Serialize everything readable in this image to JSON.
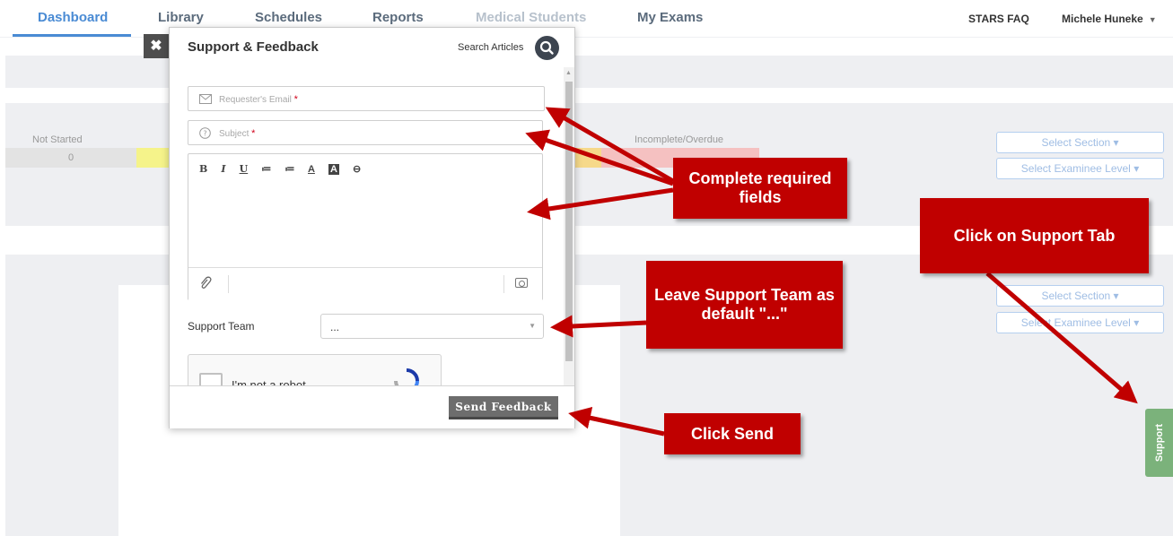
{
  "nav": {
    "items": [
      {
        "label": "Dashboard",
        "state": "active"
      },
      {
        "label": "Library",
        "state": "normal"
      },
      {
        "label": "Schedules",
        "state": "normal"
      },
      {
        "label": "Reports",
        "state": "normal"
      },
      {
        "label": "Medical Students",
        "state": "disabled"
      },
      {
        "label": "My Exams",
        "state": "normal"
      }
    ],
    "faq": "STARS FAQ",
    "user": "Michele Huneke"
  },
  "dashboard": {
    "status_not_started": "Not Started",
    "status_not_started_count": "0",
    "status_incomplete": "Incomplete/Overdue",
    "select_section": "Select Section",
    "select_examinee_level": "Select Examinee Level"
  },
  "panel": {
    "close_symbol": "✖",
    "title": "Support & Feedback",
    "search_label": "Search Articles",
    "email_placeholder": "Requester's Email",
    "subject_placeholder": "Subject",
    "required_mark": "*",
    "toolbar": [
      "B",
      "I",
      "U",
      "≔",
      "≔",
      "A",
      "A",
      "⊖"
    ],
    "support_team_label": "Support Team",
    "support_team_value": "...",
    "captcha_text": "I'm not a robot",
    "send_button": "Send Feedback"
  },
  "annotations": {
    "complete_fields": "Complete required fields",
    "click_support_tab": "Click on Support Tab",
    "leave_team_default": "Leave Support Team as default \"...\"",
    "click_send": "Click Send"
  },
  "support_tab": "Support",
  "colors": {
    "accent": "#4a8bd4",
    "callout": "#c00000",
    "support_tab": "#7bb27b",
    "send_button": "#6d6d6d"
  },
  "icons": [
    "close-icon",
    "search-icon",
    "envelope-icon",
    "question-icon",
    "paperclip-icon",
    "camera-icon",
    "chevron-down-icon",
    "recaptcha-icon"
  ]
}
